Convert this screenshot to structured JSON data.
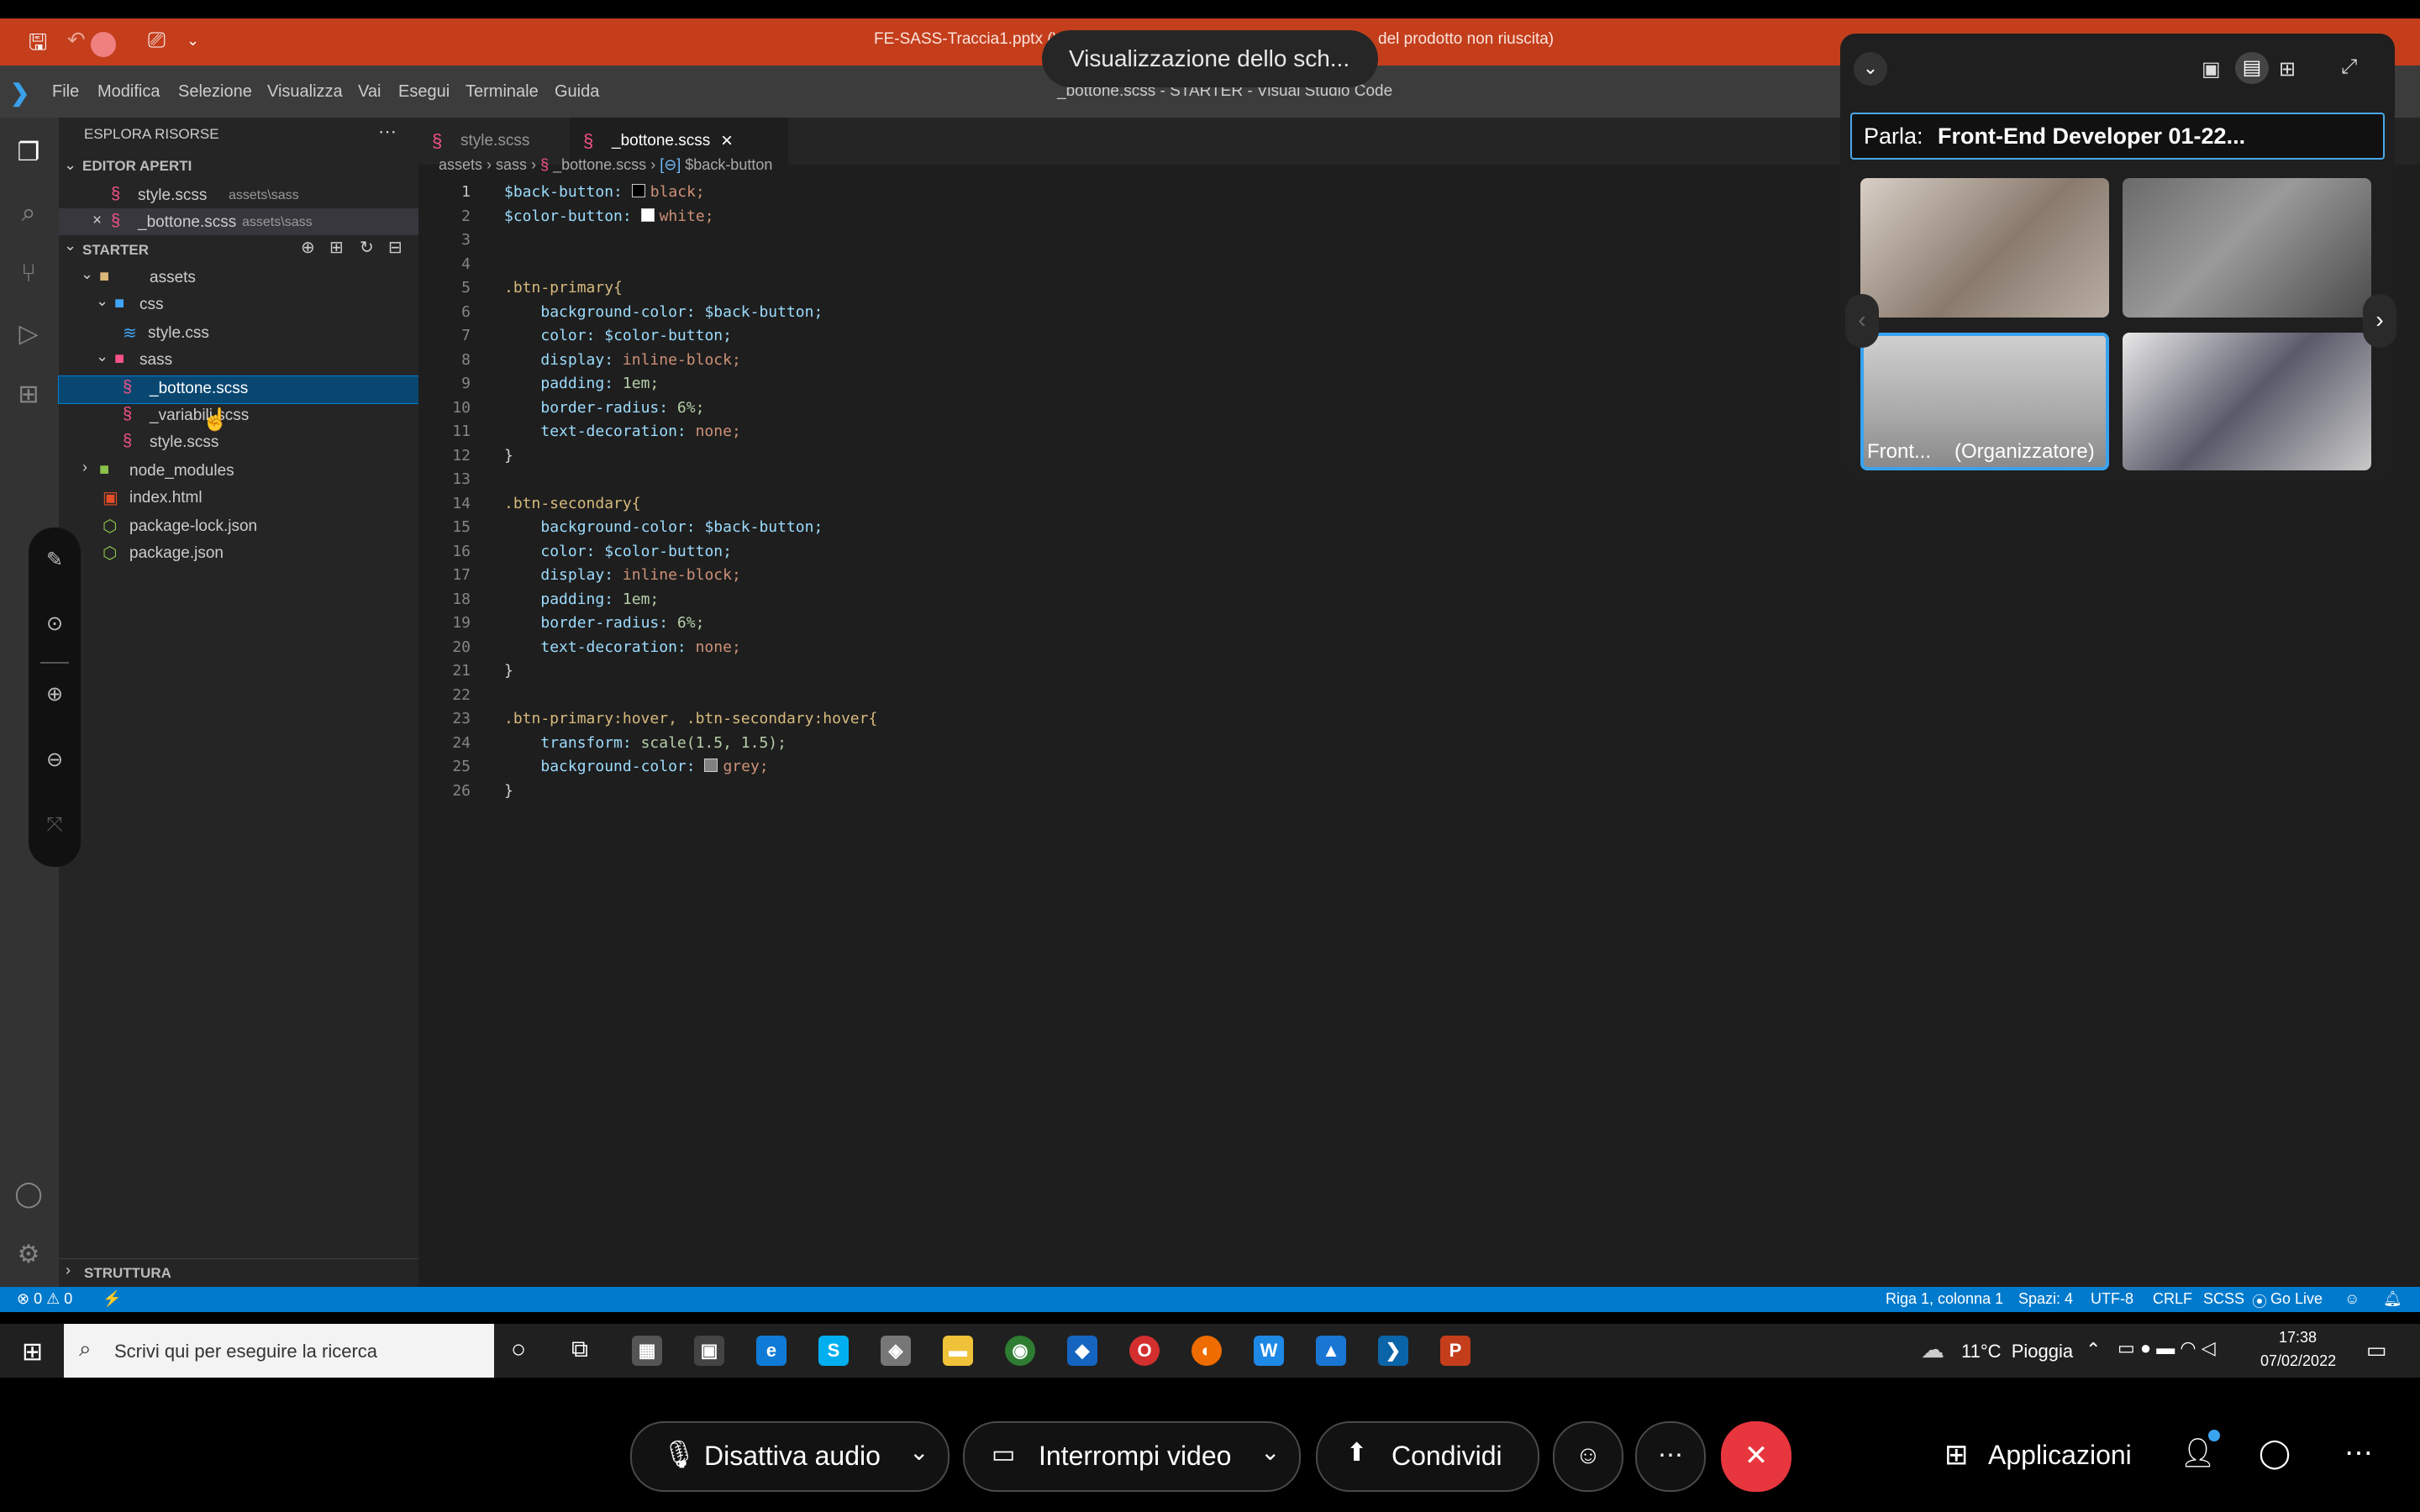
{
  "ppt": {
    "title": "FE-SASS-Traccia1.pptx (V",
    "title_tail": "del prodotto non riuscita)"
  },
  "sharing": {
    "text": "Visualizzazione dello sch..."
  },
  "vscode": {
    "menu": [
      "File",
      "Modifica",
      "Selezione",
      "Visualizza",
      "Vai",
      "Esegui",
      "Terminale",
      "Guida"
    ],
    "window_title": "_bottone.scss - STARTER - Visual Studio Code",
    "explorer_title": "ESPLORA RISORSE",
    "open_editors_header": "EDITOR APERTI",
    "open_editors": [
      {
        "name": "style.scss",
        "path": "assets\\sass"
      },
      {
        "name": "_bottone.scss",
        "path": "assets\\sass"
      }
    ],
    "project_header": "STARTER",
    "tree": [
      "assets",
      "css",
      "style.css",
      "sass",
      "_bottone.scss",
      "_variabili.scss",
      "style.scss",
      "node_modules",
      "index.html",
      "package-lock.json",
      "package.json"
    ],
    "outline_header": "STRUTTURA",
    "tabs": [
      "style.scss",
      "_bottone.scss"
    ],
    "breadcrumb": [
      "assets",
      "sass",
      "_bottone.scss",
      "$back-button"
    ],
    "line_numbers": [
      "1",
      "2",
      "3",
      "4",
      "5",
      "6",
      "7",
      "8",
      "9",
      "10",
      "11",
      "12",
      "13",
      "14",
      "15",
      "16",
      "17",
      "18",
      "19",
      "20",
      "21",
      "22",
      "23",
      "24",
      "25",
      "26"
    ],
    "code": {
      "l1_var": "$back-button:",
      "l1_val": "black;",
      "l2_var": "$color-button:",
      "l2_val": "white;",
      "l5": ".btn-primary{",
      "l6_p": "background-color:",
      "l6_v": "$back-button;",
      "l7_p": "color:",
      "l7_v": "$color-button;",
      "l8_p": "display:",
      "l8_v": "inline-block;",
      "l9_p": "padding:",
      "l9_v": "1em;",
      "l10_p": "border-radius:",
      "l10_v": "6%;",
      "l11_p": "text-decoration:",
      "l11_v": "none;",
      "l12": "}",
      "l14": ".btn-secondary{",
      "l15_p": "background-color:",
      "l15_v": "$back-button;",
      "l16_p": "color:",
      "l16_v": "$color-button;",
      "l17_p": "display:",
      "l17_v": "inline-block;",
      "l18_p": "padding:",
      "l18_v": "1em;",
      "l19_p": "border-radius:",
      "l19_v": "6%;",
      "l20_p": "text-decoration:",
      "l20_v": "none;",
      "l21": "}",
      "l23": ".btn-primary:hover, .btn-secondary:hover{",
      "l24_p": "transform:",
      "l24_v": "scale(1.5, 1.5);",
      "l25_p": "background-color:",
      "l25_v": "grey;",
      "l26": "}"
    },
    "status": {
      "problems": "⊗ 0 ⚠ 0",
      "position": "Riga 1, colonna 1",
      "spaces": "Spazi: 4",
      "encoding": "UTF-8",
      "eol": "CRLF",
      "language": "SCSS",
      "golive": "Go Live"
    }
  },
  "webex": {
    "speaker_label": "Parla:",
    "speaker_name": "Front-End Developer 01-22...",
    "tile_name": "Front...",
    "tile_role": "(Organizzatore)"
  },
  "taskbar": {
    "search_placeholder": "Scrivi qui per eseguire la ricerca",
    "weather": "11°C  Pioggia",
    "time": "17:38",
    "date": "07/02/2022"
  },
  "controls": {
    "mute": "Disattiva audio",
    "video": "Interrompi video",
    "share": "Condividi",
    "apps": "Applicazioni"
  },
  "colors": {
    "ppt_red": "#c43e1c",
    "vscode_blue": "#007acc",
    "end_call_red": "#e8363e"
  }
}
